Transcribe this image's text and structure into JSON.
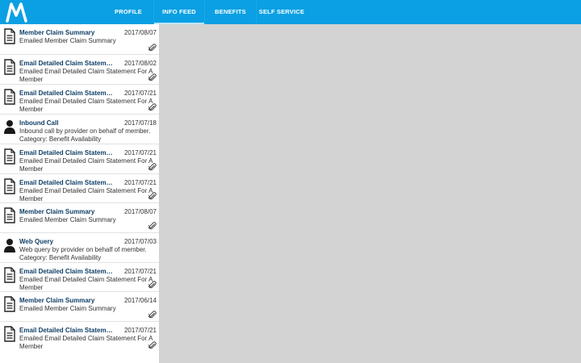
{
  "header": {
    "logo_icon": "m-logo-icon",
    "tabs": [
      {
        "label": "PROFILE",
        "active": false
      },
      {
        "label": "INFO FEED",
        "active": true
      },
      {
        "label": "BENEFITS",
        "active": false
      },
      {
        "label": "SELF SERVICE",
        "active": false
      }
    ]
  },
  "colors": {
    "accent": "#0aa0e3",
    "title": "#0f3f66",
    "background": "#d3d3d3"
  },
  "feed": {
    "items": [
      {
        "icon": "document-icon",
        "title": "Member Claim Summary",
        "date": "2017/08/07",
        "desc": "Emailed Member Claim Summary",
        "attachment": true
      },
      {
        "icon": "document-icon",
        "title": "Email Detailed Claim Statement...",
        "date": "2017/08/02",
        "desc": "Emailed Email Detailed Claim Statement For A Member",
        "attachment": true
      },
      {
        "icon": "document-icon",
        "title": "Email Detailed Claim Statement...",
        "date": "2017/07/21",
        "desc": "Emailed Email Detailed Claim Statement For A Member",
        "attachment": true
      },
      {
        "icon": "person-icon",
        "title": "Inbound Call",
        "date": "2017/07/18",
        "desc": "Inbound call by provider on behalf of member. Category: Benefit Availability",
        "attachment": false
      },
      {
        "icon": "document-icon",
        "title": "Email Detailed Claim Statement...",
        "date": "2017/07/21",
        "desc": "Emailed Email Detailed Claim Statement For A Member",
        "attachment": true
      },
      {
        "icon": "document-icon",
        "title": "Email Detailed Claim Statement...",
        "date": "2017/07/21",
        "desc": "Emailed Email Detailed Claim Statement For A Member",
        "attachment": true
      },
      {
        "icon": "document-icon",
        "title": "Member Claim Summary",
        "date": "2017/08/07",
        "desc": "Emailed Member Claim Summary",
        "attachment": true
      },
      {
        "icon": "person-icon",
        "title": "Web Query",
        "date": "2017/07/03",
        "desc": "Web query by provider on behalf of member. Category: Benefit Availability",
        "attachment": false
      },
      {
        "icon": "document-icon",
        "title": "Email Detailed Claim Statement...",
        "date": "2017/07/21",
        "desc": "Emailed Email Detailed Claim Statement For A Member",
        "attachment": true
      },
      {
        "icon": "document-icon",
        "title": "Member Claim Summary",
        "date": "2017/06/14",
        "desc": "Emailed Member Claim Summary",
        "attachment": true
      },
      {
        "icon": "document-icon",
        "title": "Email Detailed Claim Statement...",
        "date": "2017/07/21",
        "desc": "Emailed Email Detailed Claim Statement For A Member",
        "attachment": true
      }
    ]
  }
}
